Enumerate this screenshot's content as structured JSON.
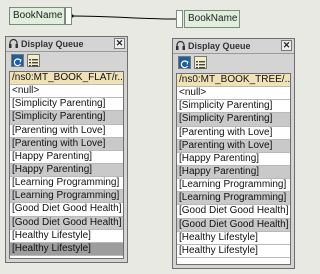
{
  "connectors": {
    "left_label": "BookName",
    "right_label": "BookName"
  },
  "panels": [
    {
      "title": "Display Queue",
      "close": "✕",
      "header_path": "/ns0:MT_BOOK_FLAT/r...",
      "rows": [
        "<null>",
        "[Simplicity Parenting]",
        "[Simplicity Parenting]",
        "[Parenting with Love]",
        "[Parenting with Love]",
        "[Happy Parenting]",
        "[Happy Parenting]",
        "[Learning Programming]",
        "[Learning Programming]",
        "[Good Diet Good Health]",
        "[Good Diet Good Health]",
        "[Healthy Lifestyle]",
        "[Healthy Lifestyle]"
      ]
    },
    {
      "title": "Display Queue",
      "close": "✕",
      "header_path": "/ns0:MT_BOOK_TREE/...",
      "rows": [
        "<null>",
        "[Simplicity Parenting]",
        "[Simplicity Parenting]",
        "[Parenting with Love]",
        "[Parenting with Love]",
        "[Happy Parenting]",
        "[Happy Parenting]",
        "[Learning Programming]",
        "[Learning Programming]",
        "[Good Diet Good Health]",
        "[Good Diet Good Health]",
        "[Healthy Lifestyle]",
        "[Healthy Lifestyle]"
      ]
    }
  ],
  "colors": {
    "header_row": "#efe2b7",
    "alt_row": "#c9c9c9",
    "selected_row": "#9d9d9d",
    "node_fill": "#dfeedd"
  }
}
